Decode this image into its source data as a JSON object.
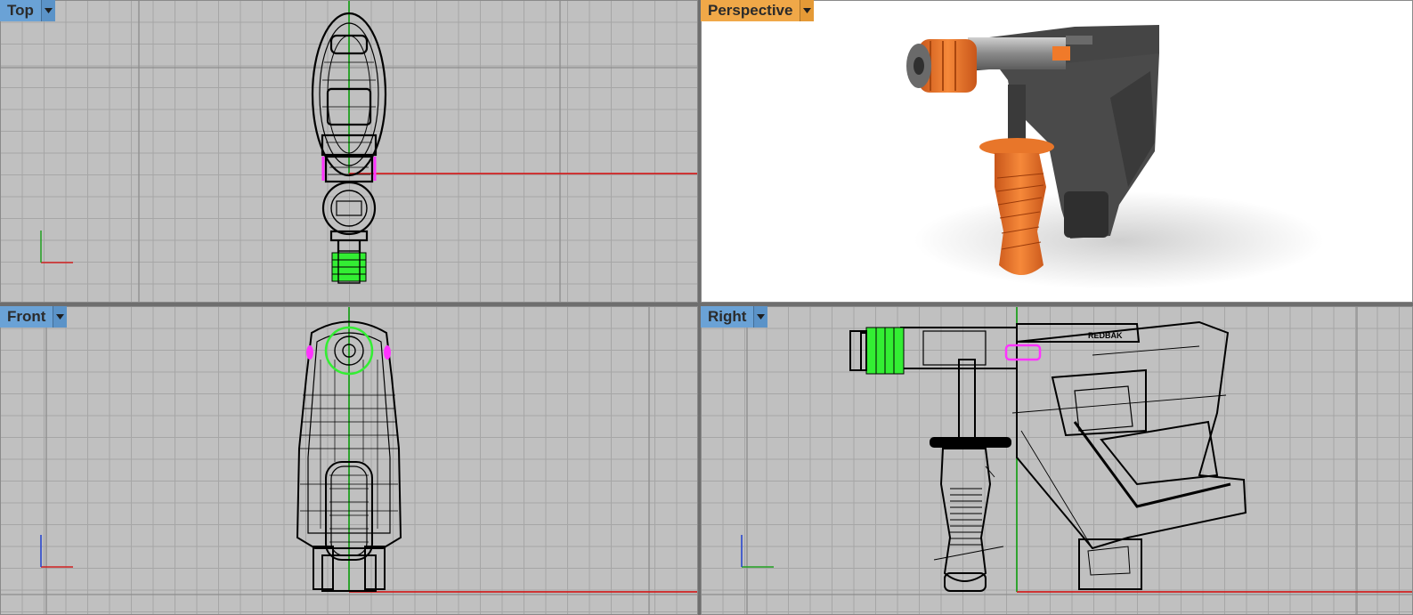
{
  "viewports": [
    {
      "id": "top",
      "label": "Top",
      "tab_color": "#6aa2d6",
      "menu_icon": "dropdown-arrow-icon"
    },
    {
      "id": "perspective",
      "label": "Perspective",
      "tab_color": "#f0a848",
      "menu_icon": "dropdown-arrow-icon"
    },
    {
      "id": "front",
      "label": "Front",
      "tab_color": "#6aa2d6",
      "menu_icon": "dropdown-arrow-icon"
    },
    {
      "id": "right",
      "label": "Right",
      "tab_color": "#6aa2d6",
      "menu_icon": "dropdown-arrow-icon"
    }
  ],
  "axis_colors": {
    "x": "#d02020",
    "y": "#20a020",
    "z": "#2040d0"
  },
  "selection_colors": {
    "green": "#33ee33",
    "magenta": "#ff33ff"
  },
  "model_colors": {
    "body": "#4a4a4a",
    "accent": "#f07a2a",
    "metal": "#8a8a8a"
  },
  "right_view_brand": "REDBAK"
}
